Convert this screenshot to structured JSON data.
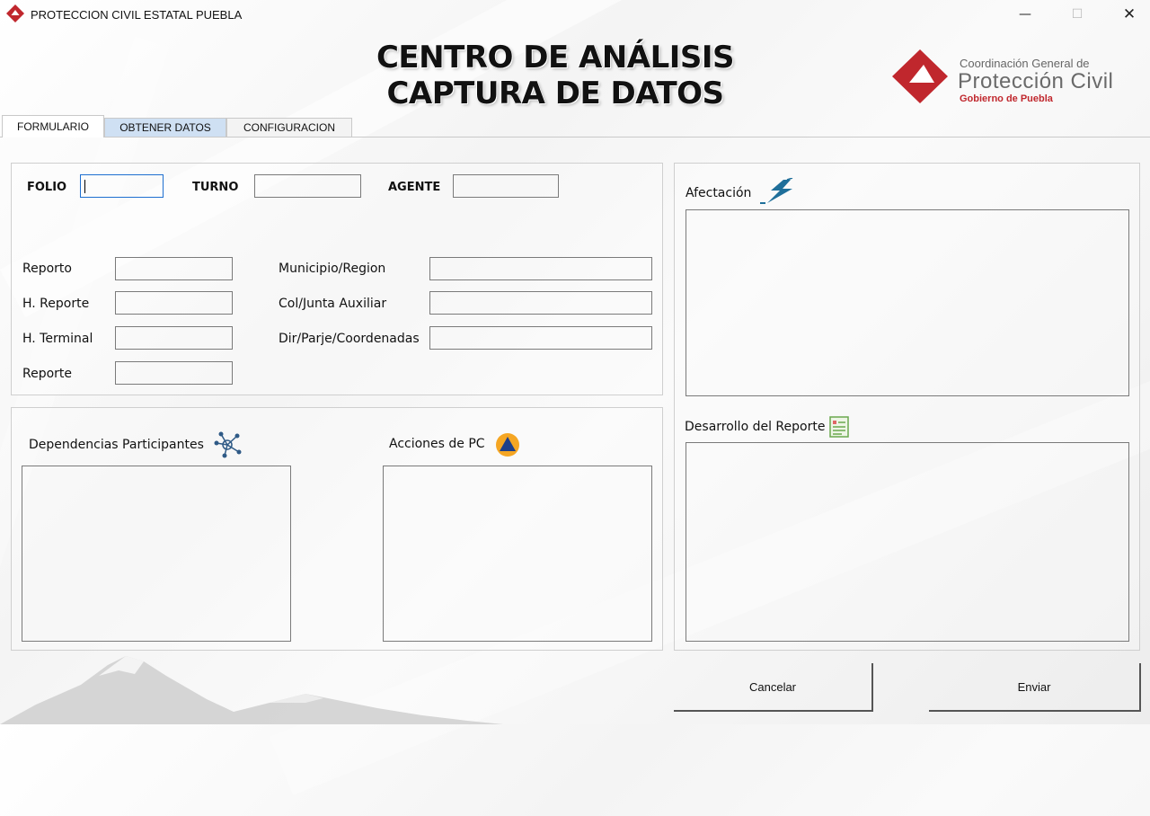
{
  "window": {
    "title": "PROTECCION CIVIL ESTATAL PUEBLA",
    "minimize": "—",
    "maximize": "☐",
    "close": "✕"
  },
  "header": {
    "line1": "CENTRO DE ANÁLISIS",
    "line2": "CAPTURA DE DATOS"
  },
  "logo": {
    "line1": "Coordinación General de",
    "line2": "Protección Civil",
    "line3": "Gobierno de Puebla",
    "color": "#c0272d"
  },
  "tabs": [
    {
      "label": "FORMULARIO"
    },
    {
      "label": "OBTENER DATOS"
    },
    {
      "label": "CONFIGURACION"
    }
  ],
  "form": {
    "folio_label": "FOLIO",
    "turno_label": "TURNO",
    "agente_label": "AGENTE",
    "reporto_label": "Reporto",
    "h_reporte_label": "H. Reporte",
    "h_terminal_label": "H. Terminal",
    "reporte_label": "Reporte",
    "municipio_label": "Municipio/Region",
    "col_label": "Col/Junta Auxiliar",
    "dir_label": "Dir/Parje/Coordenadas",
    "dependencias_label": "Dependencias Participantes",
    "acciones_label": "Acciones de PC",
    "afectacion_label": "Afectación",
    "desarrollo_label": "Desarrollo del Reporte"
  },
  "buttons": {
    "cancel": "Cancelar",
    "send": "Enviar"
  },
  "colors": {
    "focus_border": "#1e6fd0",
    "tab_blue": "#cfe0f3"
  }
}
